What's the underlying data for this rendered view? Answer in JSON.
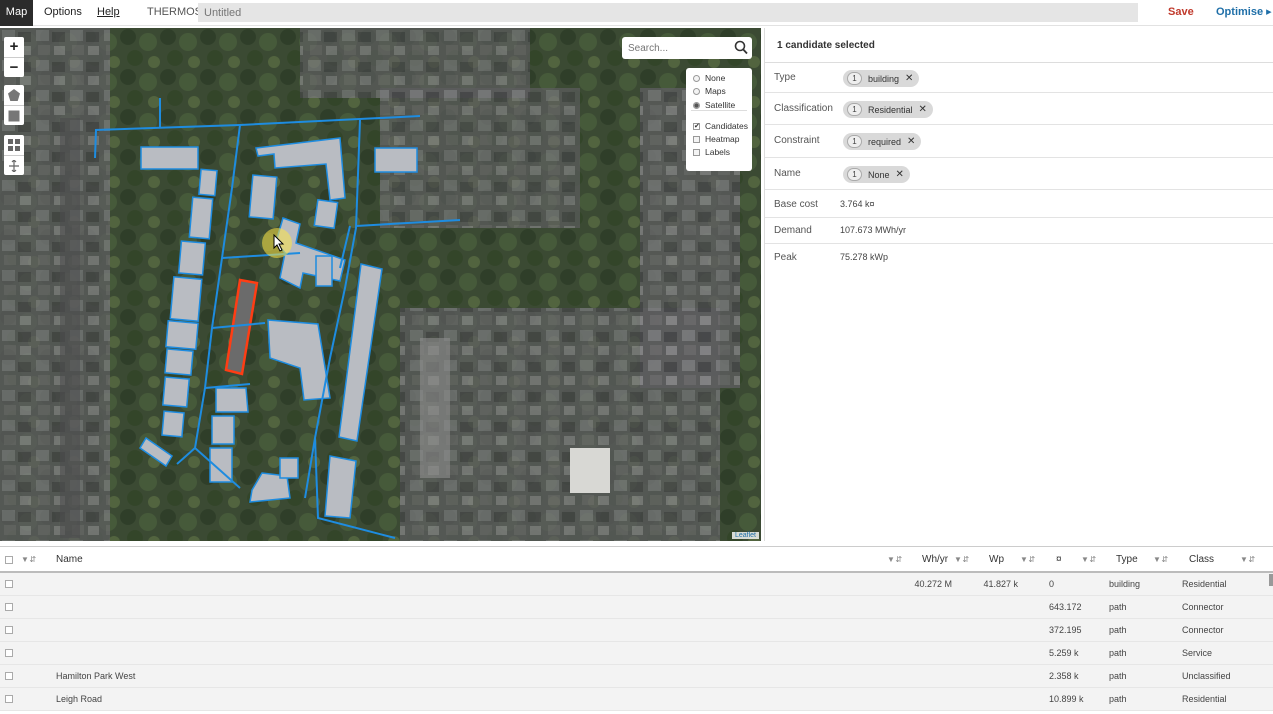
{
  "topbar": {
    "menu": [
      "Map",
      "Options",
      "Help"
    ],
    "app_name": "THERMOS",
    "doc_title_placeholder": "Untitled",
    "save_label": "Save",
    "optimise_label": "Optimise ▸"
  },
  "map": {
    "zoom_in": "+",
    "zoom_out": "−",
    "search_placeholder": "Search...",
    "layers": {
      "basemaps": [
        {
          "label": "None",
          "selected": false
        },
        {
          "label": "Maps",
          "selected": false
        },
        {
          "label": "Satellite",
          "selected": true
        }
      ],
      "overlays": [
        {
          "label": "Candidates",
          "checked": true
        },
        {
          "label": "Heatmap",
          "checked": false
        },
        {
          "label": "Labels",
          "checked": false
        }
      ]
    },
    "attribution": "Leaflet",
    "colors": {
      "path": "#1e8ce0",
      "selected": "#ff3d14",
      "building": "#b9bcc2"
    }
  },
  "details": {
    "title": "1 candidate selected",
    "chip_rows": [
      {
        "label": "Type",
        "count": "1",
        "value": "building"
      },
      {
        "label": "Classification",
        "count": "1",
        "value": "Residential"
      },
      {
        "label": "Constraint",
        "count": "1",
        "value": "required"
      },
      {
        "label": "Name",
        "count": "1",
        "value": "None"
      }
    ],
    "value_rows": [
      {
        "label": "Base cost",
        "value": "3.764 k¤"
      },
      {
        "label": "Demand",
        "value": "107.673 MWh/yr"
      },
      {
        "label": "Peak",
        "value": "75.278 kWp"
      }
    ]
  },
  "table": {
    "columns": {
      "name": "Name",
      "demand": "Wh/yr",
      "peak": "Wp",
      "cost": "¤",
      "type": "Type",
      "class": "Class"
    },
    "filter_glyph": "▼⇵",
    "rows": [
      {
        "name": "",
        "demand": "40.272 M",
        "peak": "41.827 k",
        "cost": "0",
        "type": "building",
        "class": "Residential"
      },
      {
        "name": "",
        "demand": "",
        "peak": "",
        "cost": "643.172",
        "type": "path",
        "class": "Connector"
      },
      {
        "name": "",
        "demand": "",
        "peak": "",
        "cost": "372.195",
        "type": "path",
        "class": "Connector"
      },
      {
        "name": "",
        "demand": "",
        "peak": "",
        "cost": "5.259 k",
        "type": "path",
        "class": "Service"
      },
      {
        "name": "Hamilton Park West",
        "demand": "",
        "peak": "",
        "cost": "2.358 k",
        "type": "path",
        "class": "Unclassified"
      },
      {
        "name": "Leigh Road",
        "demand": "",
        "peak": "",
        "cost": "10.899 k",
        "type": "path",
        "class": "Residential"
      }
    ]
  }
}
